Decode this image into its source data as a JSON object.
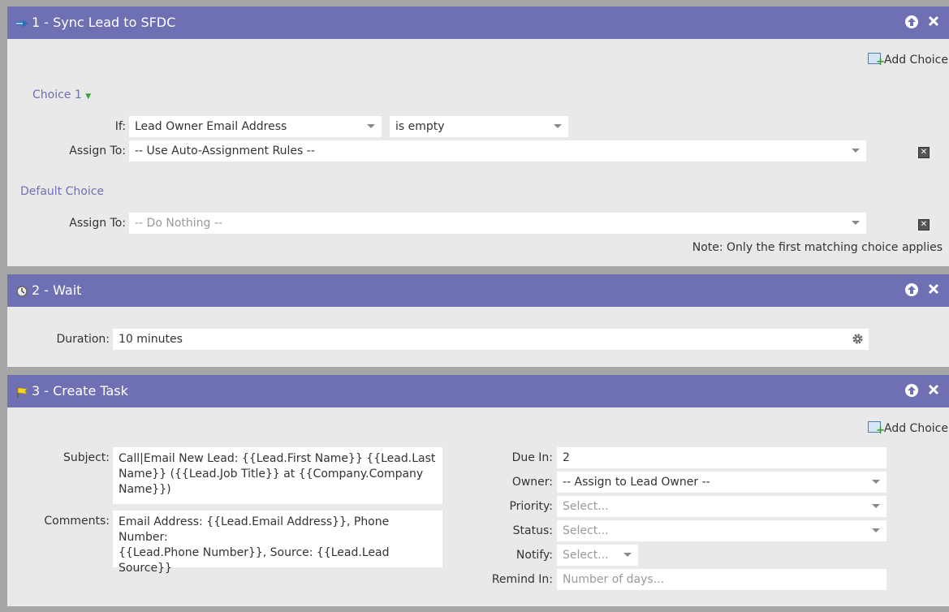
{
  "panel1": {
    "title": "1 - Sync Lead to SFDC",
    "add_choice": "Add Choice",
    "choice_label": "Choice 1",
    "if_label": "If:",
    "if_field": "Lead Owner Email Address",
    "if_operator": "is empty",
    "assign_label": "Assign To:",
    "assign_value": "-- Use Auto-Assignment Rules --",
    "default_choice_label": "Default Choice",
    "default_assign_label": "Assign To:",
    "default_assign_value": "-- Do Nothing --",
    "note": "Note: Only the first matching choice applies"
  },
  "panel2": {
    "title": "2 - Wait",
    "duration_label": "Duration:",
    "duration_value": "10 minutes"
  },
  "panel3": {
    "title": "3 - Create Task",
    "add_choice": "Add Choice",
    "subject_label": "Subject:",
    "subject_line1": "Call|Email New Lead: {{Lead.First Name}} {{Lead.Last",
    "subject_line2": "Name}} ({{Lead.Job Title}} at {{Company.Company Name}})",
    "comments_label": "Comments:",
    "comments_line1": "Email Address: {{Lead.Email Address}}, Phone Number:",
    "comments_line2": "{{Lead.Phone Number}}, Source: {{Lead.Lead Source}}",
    "due_label": "Due In:",
    "due_value": "2",
    "owner_label": "Owner:",
    "owner_value": "-- Assign to Lead Owner --",
    "priority_label": "Priority:",
    "priority_placeholder": "Select...",
    "status_label": "Status:",
    "status_placeholder": "Select...",
    "notify_label": "Notify:",
    "notify_placeholder": "Select...",
    "remind_label": "Remind In:",
    "remind_placeholder": "Number of days..."
  },
  "colors": {
    "header": "#6f6fb3",
    "panel_bg": "#e9e9e9",
    "page_bg": "#a6a6a6"
  },
  "icons": [
    "sync-arrow-icon",
    "clock-icon",
    "flag-icon",
    "move-up-icon",
    "close-icon",
    "add-choice-icon",
    "delete-choice-icon",
    "gear-icon",
    "dropdown-caret-icon"
  ]
}
